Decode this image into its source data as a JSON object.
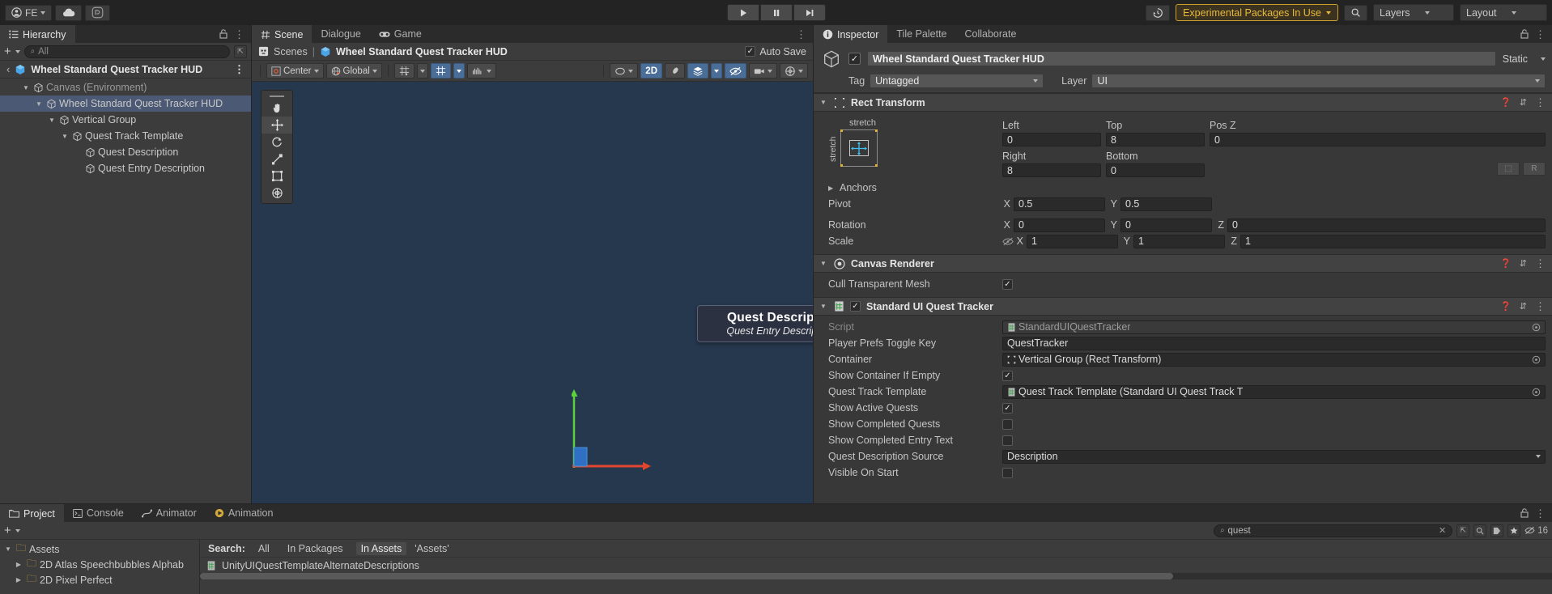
{
  "toolbar": {
    "account_label": "FE",
    "cloud_icon": "cloud-icon",
    "services_icon": "unity-services-icon",
    "play_icon": "play-icon",
    "pause_icon": "pause-icon",
    "step_icon": "step-icon",
    "history_icon": "history-icon",
    "experimental_label": "Experimental Packages In Use",
    "search_icon": "search-icon",
    "layers_label": "Layers",
    "layout_label": "Layout"
  },
  "hierarchy": {
    "tab_label": "Hierarchy",
    "tab_icon": "hierarchy-icon",
    "lock_icon": "lock-icon",
    "menu_icon": "kebab-icon",
    "add_label": "+",
    "search_placeholder": "All",
    "breadcrumb": "Wheel Standard Quest Tracker HUD",
    "items": [
      {
        "label": "Canvas (Environment)",
        "indent": 1,
        "expanded": true,
        "selected": false,
        "dim": true
      },
      {
        "label": "Wheel Standard Quest Tracker HUD",
        "indent": 2,
        "expanded": true,
        "selected": true,
        "dim": false
      },
      {
        "label": "Vertical Group",
        "indent": 3,
        "expanded": true,
        "selected": false,
        "dim": false
      },
      {
        "label": "Quest Track Template",
        "indent": 4,
        "expanded": true,
        "selected": false,
        "dim": false
      },
      {
        "label": "Quest Description",
        "indent": 5,
        "expanded": false,
        "selected": false,
        "dim": false
      },
      {
        "label": "Quest Entry Description",
        "indent": 5,
        "expanded": false,
        "selected": false,
        "dim": false
      }
    ]
  },
  "scene": {
    "tabs": [
      {
        "label": "Scene",
        "icon": "grid-icon",
        "active": true
      },
      {
        "label": "Dialogue",
        "icon": "",
        "active": false
      },
      {
        "label": "Game",
        "icon": "gamepad-icon",
        "active": false
      }
    ],
    "menu_icon": "kebab-icon",
    "breadcrumb_root": "Scenes",
    "breadcrumb_current": "Wheel Standard Quest Tracker HUD",
    "auto_save_label": "Auto Save",
    "auto_save_checked": true,
    "tools": {
      "pivot_label": "Center",
      "space_label": "Global",
      "grid_toggle": "grid-icon",
      "snap_toggle": "snap-icon",
      "audio_icon": "audio-icon",
      "mode_2d_label": "2D",
      "lighting_icon": "lighting-icon",
      "fx_icon": "fx-icon",
      "layers_icon": "layers-icon",
      "visibility_icon": "eye-off-icon",
      "camera_icon": "camera-icon",
      "gizmos_icon": "gizmos-icon"
    },
    "palette": [
      "hand-tool",
      "move-tool",
      "rotate-tool",
      "scale-tool",
      "rect-tool",
      "transform-tool"
    ],
    "hud_title": "Quest Description",
    "hud_subtitle": "Quest Entry Descriptions",
    "axis_colors": {
      "x": "#e2462f",
      "y": "#5dd13b",
      "z": "#2f6fc4"
    }
  },
  "inspector": {
    "tabs": [
      {
        "label": "Inspector",
        "icon": "info-icon",
        "active": true
      },
      {
        "label": "Tile Palette",
        "icon": "",
        "active": false
      },
      {
        "label": "Collaborate",
        "icon": "",
        "active": false
      }
    ],
    "lock_icon": "lock-icon",
    "menu_icon": "kebab-icon",
    "object_enabled": true,
    "object_name": "Wheel Standard Quest Tracker HUD",
    "static_label": "Static",
    "tag_label": "Tag",
    "tag_value": "Untagged",
    "layer_label": "Layer",
    "layer_value": "UI",
    "rect_transform": {
      "title": "Rect Transform",
      "anchor_preset_top": "stretch",
      "anchor_preset_left": "stretch",
      "left_label": "Left",
      "left_value": "0",
      "top_label": "Top",
      "top_value": "8",
      "posz_label": "Pos Z",
      "posz_value": "0",
      "right_label": "Right",
      "right_value": "8",
      "bottom_label": "Bottom",
      "bottom_value": "0",
      "anchors_label": "Anchors",
      "pivot_label": "Pivot",
      "pivot_x": "0.5",
      "pivot_y": "0.5",
      "rotation_label": "Rotation",
      "rot_x": "0",
      "rot_y": "0",
      "rot_z": "0",
      "scale_label": "Scale",
      "scale_x": "1",
      "scale_y": "1",
      "scale_z": "1",
      "x": "X",
      "y": "Y",
      "z": "Z",
      "blank_label": "R"
    },
    "canvas_renderer": {
      "title": "Canvas Renderer",
      "cull_label": "Cull Transparent Mesh",
      "cull_checked": true
    },
    "quest_tracker": {
      "title": "Standard UI Quest Tracker",
      "enabled": true,
      "fields": [
        {
          "label": "Script",
          "value": "StandardUIQuestTracker",
          "type": "object",
          "dim": true,
          "icon": "script-icon"
        },
        {
          "label": "Player Prefs Toggle Key",
          "value": "QuestTracker",
          "type": "text",
          "dim": false,
          "icon": ""
        },
        {
          "label": "Container",
          "value": "Vertical Group (Rect Transform)",
          "type": "object",
          "dim": false,
          "icon": "rect-icon"
        },
        {
          "label": "Show Container If Empty",
          "value": true,
          "type": "bool",
          "dim": false,
          "icon": ""
        },
        {
          "label": "Quest Track Template",
          "value": "Quest Track Template (Standard UI Quest Track T",
          "type": "object",
          "dim": false,
          "icon": "script-icon"
        },
        {
          "label": "Show Active Quests",
          "value": true,
          "type": "bool",
          "dim": false,
          "icon": ""
        },
        {
          "label": "Show Completed Quests",
          "value": false,
          "type": "bool",
          "dim": false,
          "icon": ""
        },
        {
          "label": "Show Completed Entry Text",
          "value": false,
          "type": "bool",
          "dim": false,
          "icon": ""
        },
        {
          "label": "Quest Description Source",
          "value": "Description",
          "type": "dropdown",
          "dim": false,
          "icon": ""
        },
        {
          "label": "Visible On Start",
          "value": false,
          "type": "bool",
          "dim": false,
          "icon": ""
        }
      ]
    }
  },
  "project": {
    "tabs": [
      {
        "label": "Project",
        "icon": "folder-icon",
        "active": true
      },
      {
        "label": "Console",
        "icon": "console-icon",
        "active": false
      },
      {
        "label": "Animator",
        "icon": "animator-icon",
        "active": false
      },
      {
        "label": "Animation",
        "icon": "animation-icon",
        "active": false
      }
    ],
    "lock_icon": "lock-icon",
    "menu_icon": "kebab-icon",
    "add_label": "+",
    "search_value": "quest",
    "search_icon": "search-icon",
    "clear_icon": "clear-icon",
    "badge_count": "16",
    "search_row": {
      "label": "Search:",
      "all": "All",
      "in_packages": "In Packages",
      "in_assets": "In Assets",
      "scope": "'Assets'"
    },
    "tree": [
      {
        "label": "Assets",
        "indent": 0,
        "expanded": true,
        "folder": true
      },
      {
        "label": "2D Atlas Speechbubbles Alphab",
        "indent": 1,
        "expanded": false,
        "folder": true
      },
      {
        "label": "2D Pixel Perfect",
        "indent": 1,
        "expanded": false,
        "folder": true
      }
    ],
    "results": [
      {
        "label": "UnityUIQuestTemplateAlternateDescriptions",
        "icon": "prefab-icon"
      }
    ]
  }
}
